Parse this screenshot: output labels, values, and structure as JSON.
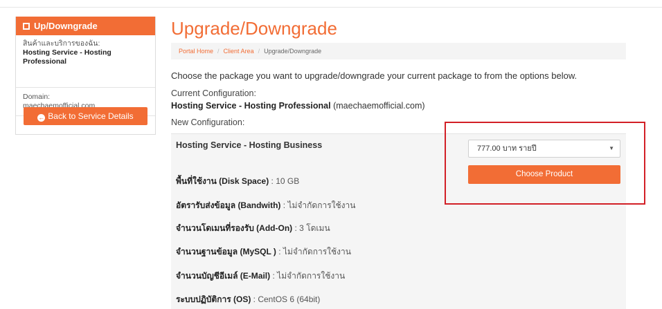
{
  "sidebar": {
    "title": "Up/Downgrade",
    "product_label": "สินค้าและบริการของฉัน:",
    "product_value": "Hosting Service - Hosting Professional",
    "domain_label": "Domain:",
    "domain_value": "maechaemofficial.com",
    "back_button": "Back to Service Details"
  },
  "main": {
    "page_title": "Upgrade/Downgrade",
    "breadcrumb": [
      "Portal Home",
      "Client Area",
      "Upgrade/Downgrade"
    ],
    "description": "Choose the package you want to upgrade/downgrade your current package to from the options below.",
    "current_label": "Current Configuration:",
    "current_package": "Hosting Service - Hosting Professional",
    "current_domain": "(maechaemofficial.com)",
    "new_label": "New Configuration:"
  },
  "option": {
    "package_name": "Hosting Service - Hosting Business",
    "features": [
      {
        "label": "พื้นที่ใช้งาน (Disk Space)",
        "value": ": 10 GB"
      },
      {
        "label": "อัตรารับส่งข้อมูล (Bandwith)",
        "value": ": ไม่จำกัดการใช้งาน"
      },
      {
        "label": "จำนวนโดเมนที่รองรับ (Add-On)",
        "value": ": 3 โดเมน"
      },
      {
        "label": "จำนวนฐานข้อมูล (MySQL )",
        "value": ": ไม่จำกัดการใช้งาน"
      },
      {
        "label": "จำนวนบัญชีอีเมล์ (E-Mail)",
        "value": ": ไม่จำกัดการใช้งาน"
      },
      {
        "label": "ระบบปฏิบัติการ (OS)",
        "value": ": CentOS 6 (64bit)"
      }
    ],
    "billing_select": "777.00 บาท รายปี",
    "choose_button": "Choose Product"
  },
  "colors": {
    "accent": "#f26d35",
    "highlight_box": "#d21f26",
    "panel_bg": "#f5f5f5"
  }
}
